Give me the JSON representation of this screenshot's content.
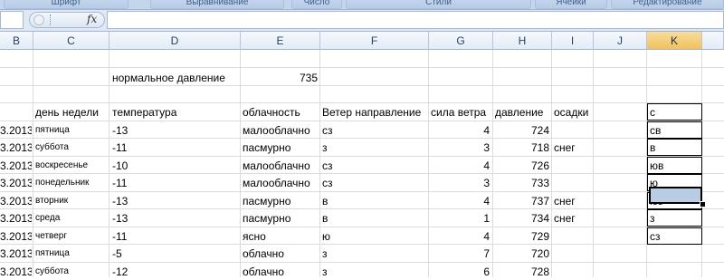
{
  "ribbon": {
    "groups": [
      "Шрифт",
      "Выравнивание",
      "Число",
      "Стили",
      "Ячейки",
      "Редактирование"
    ]
  },
  "formula_bar": {
    "fx_label": "fx",
    "value": ""
  },
  "columns": [
    "B",
    "C",
    "D",
    "E",
    "F",
    "G",
    "H",
    "I",
    "J",
    "K"
  ],
  "selected_column": "K",
  "sheet": {
    "note_label": "нормальное давление",
    "note_value": "735",
    "headers": {
      "day": "день недели",
      "temp": "температура",
      "cloud": "облачность",
      "wind_dir": "Ветер направление",
      "wind_force": "сила ветра",
      "pressure": "давление",
      "precip": "осадки"
    },
    "rows": [
      {
        "date": "3.2013",
        "day": "пятница",
        "temp": "-13",
        "cloud": "малооблачно",
        "wind_dir": "сз",
        "wind_force": "4",
        "pressure": "724",
        "precip": ""
      },
      {
        "date": "3.2013",
        "day": "суббота",
        "temp": "-11",
        "cloud": "пасмурно",
        "wind_dir": "з",
        "wind_force": "3",
        "pressure": "718",
        "precip": "снег"
      },
      {
        "date": "3.2013",
        "day": "воскресенье",
        "temp": "-10",
        "cloud": "малооблачно",
        "wind_dir": "сз",
        "wind_force": "4",
        "pressure": "726",
        "precip": ""
      },
      {
        "date": "3.2013",
        "day": "понедельник",
        "temp": "-11",
        "cloud": "малооблачно",
        "wind_dir": "сз",
        "wind_force": "3",
        "pressure": "733",
        "precip": ""
      },
      {
        "date": "3.2013",
        "day": "вторник",
        "temp": "-13",
        "cloud": "пасмурно",
        "wind_dir": "в",
        "wind_force": "4",
        "pressure": "737",
        "precip": "снег"
      },
      {
        "date": "3.2013",
        "day": "среда",
        "temp": "-13",
        "cloud": "пасмурно",
        "wind_dir": "в",
        "wind_force": "1",
        "pressure": "734",
        "precip": "снег"
      },
      {
        "date": "3.2013",
        "day": "четверг",
        "temp": "-11",
        "cloud": "ясно",
        "wind_dir": "ю",
        "wind_force": "4",
        "pressure": "729",
        "precip": ""
      },
      {
        "date": "3.2013",
        "day": "пятница",
        "temp": "-5",
        "cloud": "облачно",
        "wind_dir": "з",
        "wind_force": "7",
        "pressure": "720",
        "precip": ""
      },
      {
        "date": "3.2013",
        "day": "суббота",
        "temp": "-12",
        "cloud": "облачно",
        "wind_dir": "з",
        "wind_force": "6",
        "pressure": "728",
        "precip": ""
      }
    ],
    "k_column": [
      "с",
      "св",
      "в",
      "юв",
      "ю",
      "юз",
      "з",
      "сз",
      ""
    ]
  },
  "colors": {
    "selected_cell": "#b8cce4",
    "selected_header": "#f1c15f",
    "ribbon": "#c4d6ec"
  }
}
